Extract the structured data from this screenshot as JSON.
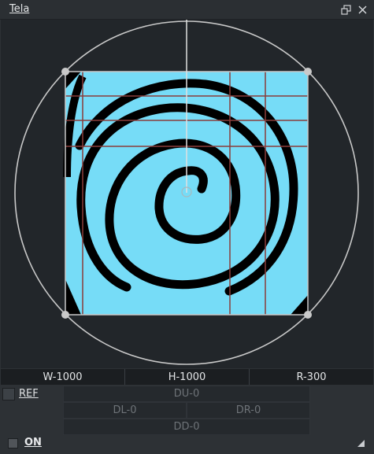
{
  "window": {
    "title": "Tela",
    "icons": {
      "float": "float-window-icon",
      "close": "close-icon"
    }
  },
  "colors": {
    "background": "#2d3135",
    "canvas_background": "#22262a",
    "image_fill": "#76dcf7",
    "spiral": "#000000",
    "guide_lines": "#8a3d3a",
    "frame": "#c9c9c9"
  },
  "params": {
    "width": "W-1000",
    "height": "H-1000",
    "radius": "R-300"
  },
  "ref": {
    "label": "REF"
  },
  "offsets": {
    "up": "DU-0",
    "left": "DL-0",
    "right": "DR-0",
    "down": "DD-0"
  },
  "toggle": {
    "label": "ON"
  }
}
